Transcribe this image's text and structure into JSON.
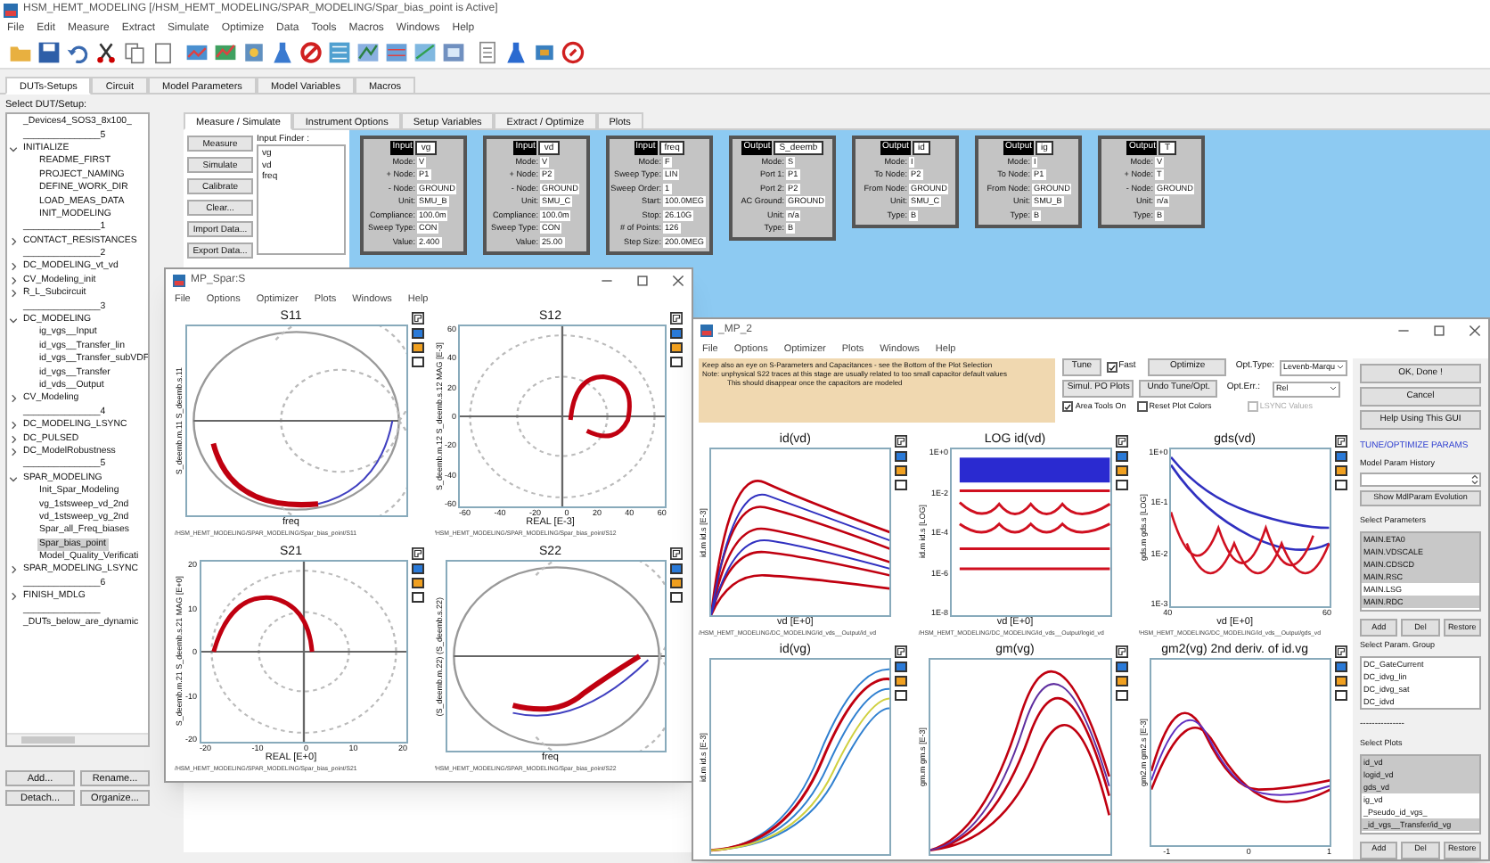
{
  "app": {
    "title": "HSM_HEMT_MODELING [/HSM_HEMT_MODELING/SPAR_MODELING/Spar_bias_point is Active]",
    "menu": [
      "File",
      "Edit",
      "Measure",
      "Extract",
      "Simulate",
      "Optimize",
      "Data",
      "Tools",
      "Macros",
      "Windows",
      "Help"
    ]
  },
  "main_tabs": [
    {
      "label": "DUTs-Setups",
      "selected": true
    },
    {
      "label": "Circuit",
      "selected": false
    },
    {
      "label": "Model Parameters",
      "selected": false
    },
    {
      "label": "Model Variables",
      "selected": false
    },
    {
      "label": "Macros",
      "selected": false
    }
  ],
  "dut_panel": {
    "label": "Select DUT/Setup:",
    "tree": [
      {
        "label": "_Devices4_SOS3_8x100_"
      },
      {
        "label": "_______________5"
      },
      {
        "label": "INITIALIZE",
        "expanded": true,
        "selected": false,
        "children": [
          {
            "label": "README_FIRST",
            "selected": false
          },
          {
            "label": "PROJECT_NAMING",
            "selected": false
          },
          {
            "label": "DEFINE_WORK_DIR",
            "selected": false
          },
          {
            "label": "LOAD_MEAS_DATA",
            "selected": false
          },
          {
            "label": "INIT_MODELING",
            "selected": false
          }
        ]
      },
      {
        "label": "_______________1"
      },
      {
        "label": "CONTACT_RESISTANCES",
        "expanded": false,
        "selected": false
      },
      {
        "label": "_______________2"
      },
      {
        "label": "DC_MODELING_vt_vd",
        "expanded": false,
        "selected": false
      },
      {
        "label": "CV_Modeling_init",
        "expanded": false,
        "selected": false
      },
      {
        "label": "R_L_Subcircuit",
        "expanded": false,
        "selected": false
      },
      {
        "label": "_______________3"
      },
      {
        "label": "DC_MODELING",
        "expanded": true,
        "selected": false,
        "children": [
          {
            "label": "ig_vgs__Input",
            "selected": false
          },
          {
            "label": "id_vgs__Transfer_lin",
            "selected": false
          },
          {
            "label": "id_vgs__Transfer_subVDF",
            "selected": false
          },
          {
            "label": "id_vgs__Transfer",
            "selected": false
          },
          {
            "label": "id_vds__Output",
            "selected": false
          }
        ]
      },
      {
        "label": "CV_Modeling",
        "expanded": false,
        "selected": false
      },
      {
        "label": "_______________4"
      },
      {
        "label": "DC_MODELING_LSYNC",
        "expanded": false,
        "selected": false
      },
      {
        "label": "DC_PULSED",
        "expanded": false,
        "selected": false
      },
      {
        "label": "DC_ModelRobustness",
        "expanded": false,
        "selected": false
      },
      {
        "label": "_______________5"
      },
      {
        "label": "SPAR_MODELING",
        "expanded": true,
        "selected": false,
        "children": [
          {
            "label": "Init_Spar_Modeling",
            "selected": false
          },
          {
            "label": "vg_1stsweep_vd_2nd",
            "selected": false
          },
          {
            "label": "vd_1stsweep_vg_2nd",
            "selected": false
          },
          {
            "label": "Spar_all_Freq_biases",
            "selected": false
          },
          {
            "label": "Spar_bias_point",
            "selected": true
          },
          {
            "label": "Model_Quality_Verificati",
            "selected": false
          }
        ]
      },
      {
        "label": "SPAR_MODELING_LSYNC",
        "expanded": false,
        "selected": false
      },
      {
        "label": "_______________6"
      },
      {
        "label": "FINISH_MDLG",
        "expanded": false,
        "selected": false
      },
      {
        "label": "_______________"
      },
      {
        "label": "_DUTs_below_are_dynamic"
      }
    ],
    "buttons": [
      "Add...",
      "Rename...",
      "Detach...",
      "Organize..."
    ]
  },
  "setup_tabs": [
    {
      "label": "Measure / Simulate",
      "selected": true
    },
    {
      "label": "Instrument Options",
      "selected": false
    },
    {
      "label": "Setup Variables",
      "selected": false
    },
    {
      "label": "Extract / Optimize",
      "selected": false
    },
    {
      "label": "Plots",
      "selected": false
    }
  ],
  "action_buttons": [
    "Measure",
    "Simulate",
    "Calibrate",
    "Clear...",
    "Import Data...",
    "Export Data..."
  ],
  "input_finder": {
    "label": "Input Finder :",
    "items": [
      "vg",
      "vd",
      "freq"
    ]
  },
  "blocks": [
    {
      "header": "Input",
      "name": "vg",
      "fields": [
        [
          "Mode:",
          "V"
        ],
        [
          "+ Node:",
          "P1"
        ],
        [
          "- Node:",
          "GROUND"
        ],
        [
          "Unit:",
          "SMU_B"
        ],
        [
          "Compliance:",
          "100.0m"
        ],
        [
          "Sweep Type:",
          "CON"
        ],
        [
          "Value:",
          "2.400"
        ]
      ]
    },
    {
      "header": "Input",
      "name": "vd",
      "fields": [
        [
          "Mode:",
          "V"
        ],
        [
          "+ Node:",
          "P2"
        ],
        [
          "- Node:",
          "GROUND"
        ],
        [
          "Unit:",
          "SMU_C"
        ],
        [
          "Compliance:",
          "100.0m"
        ],
        [
          "Sweep Type:",
          "CON"
        ],
        [
          "Value:",
          "25.00"
        ]
      ]
    },
    {
      "header": "Input",
      "name": "freq",
      "fields": [
        [
          "Mode:",
          "F"
        ],
        [
          "Sweep Type:",
          "LIN"
        ],
        [
          "Sweep Order:",
          "1"
        ],
        [
          "Start:",
          "100.0MEG"
        ],
        [
          "Stop:",
          "26.10G"
        ],
        [
          "# of Points:",
          "126"
        ],
        [
          "Step Size:",
          "200.0MEG"
        ]
      ]
    },
    {
      "header": "Output",
      "name": "S_deemb",
      "fields": [
        [
          "Mode:",
          "S"
        ],
        [
          "Port 1:",
          "P1"
        ],
        [
          "Port 2:",
          "P2"
        ],
        [
          "AC Ground:",
          "GROUND"
        ],
        [
          "Unit:",
          "n/a"
        ],
        [
          "Type:",
          "B"
        ]
      ]
    },
    {
      "header": "Output",
      "name": "id",
      "fields": [
        [
          "Mode:",
          "I"
        ],
        [
          "To Node:",
          "P2"
        ],
        [
          "From Node:",
          "GROUND"
        ],
        [
          "Unit:",
          "SMU_C"
        ],
        [
          "Type:",
          "B"
        ]
      ]
    },
    {
      "header": "Output",
      "name": "ig",
      "fields": [
        [
          "Mode:",
          "I"
        ],
        [
          "To Node:",
          "P1"
        ],
        [
          "From Node:",
          "GROUND"
        ],
        [
          "Unit:",
          "SMU_B"
        ],
        [
          "Type:",
          "B"
        ]
      ]
    },
    {
      "header": "Output",
      "name": "T",
      "fields": [
        [
          "Mode:",
          "V"
        ],
        [
          "+ Node:",
          "T"
        ],
        [
          "- Node:",
          "GROUND"
        ],
        [
          "Unit:",
          "n/a"
        ],
        [
          "Type:",
          "B"
        ]
      ]
    }
  ],
  "spar_window": {
    "title": "MP_Spar:S",
    "menu": [
      "File",
      "Options",
      "Optimizer",
      "Plots",
      "Windows",
      "Help"
    ],
    "plots": [
      {
        "kind": "smith",
        "title": "S11",
        "ylabel": "S_deemb.m.11  S_deemb.s.11",
        "xlabel": "freq",
        "footer": "/HSM_HEMT_MODELING/SPAR_MODELING/Spar_bias_point/S11"
      },
      {
        "kind": "polar",
        "title": "S12",
        "ylabel": "S_deemb.m.12  S_deemb.s.12  MAG [E-3]",
        "xlabel": "REAL [E-3]",
        "yticks": [
          "60",
          "40",
          "20",
          "0",
          "-20",
          "-40",
          "-60"
        ],
        "xticks": [
          "-60",
          "-40",
          "-20",
          "0",
          "20",
          "40",
          "60"
        ],
        "footer": "/HSM_HEMT_MODELING/SPAR_MODELING/Spar_bias_point/S12"
      },
      {
        "kind": "polar-half",
        "title": "S21",
        "ylabel": "S_deemb.m.21  S_deemb.s.21  MAG [E+0]",
        "xlabel": "REAL [E+0]",
        "yticks": [
          "20",
          "10",
          "0",
          "-10",
          "-20"
        ],
        "xticks": [
          "-20",
          "-10",
          "0",
          "10",
          "20"
        ],
        "footer": "/HSM_HEMT_MODELING/SPAR_MODELING/Spar_bias_point/S21"
      },
      {
        "kind": "smith-low",
        "title": "S22",
        "ylabel": "(S_deemb.m.22)  (S_deemb.s.22)",
        "xlabel": "freq",
        "footer": "/HSM_HEMT_MODELING/SPAR_MODELING/Spar_bias_point/S22"
      }
    ]
  },
  "mp2_window": {
    "title": "_MP_2",
    "menu": [
      "File",
      "Options",
      "Optimizer",
      "Plots",
      "Windows",
      "Help"
    ],
    "note": [
      "Keep also an eye on S-Parameters and Capacitances - see the Bottom of the Plot Selection",
      "Note: unphysical S22 traces at this stage are usually related to too small capacitor default values",
      "This should disappear once the capacitors are modeled"
    ],
    "tune_button": "Tune",
    "fast": {
      "label": "Fast",
      "checked": true
    },
    "optimize_button": "Optimize",
    "simul_button": "Simul. PO Plots",
    "undo_button": "Undo Tune/Opt.",
    "area_tools": {
      "label": "Area Tools On",
      "checked": true
    },
    "reset_colors": {
      "label": "Reset Plot Colors",
      "checked": false
    },
    "opt_type": {
      "label": "Opt.Type:",
      "value": "Levenb-Marqu"
    },
    "opt_err": {
      "label": "Opt.Err.:",
      "value": "Rel"
    },
    "lsync": {
      "label": "LSYNC Values",
      "checked": false,
      "disabled": true
    },
    "plots": [
      {
        "kind": "rise",
        "title": "id(vd)",
        "ylabel": "id.m  id.s  [E-3]",
        "xlabel": "vd [E+0]",
        "footer": "/HSM_HEMT_MODELING/DC_MODELING/id_vds__Output/id_vd"
      },
      {
        "kind": "log",
        "title": "LOG id(vd)",
        "ylabel": "id.m  id.s  [LOG]",
        "xlabel": "vd [E+0]",
        "yticks": [
          "1E+0",
          "1E-2",
          "1E-4",
          "1E-6",
          "1E-8"
        ],
        "footer": "/HSM_HEMT_MODELING/DC_MODELING/id_vds__Output/logid_vd"
      },
      {
        "kind": "dips",
        "title": "gds(vd)",
        "ylabel": "gds.m  gds.s  [LOG]",
        "xlabel": "vd [E+0]",
        "yticks": [
          "1E+0",
          "1E-1",
          "1E-2",
          "1E-3"
        ],
        "xticks": [
          "40",
          "60"
        ],
        "footer": "/HSM_HEMT_MODELING/DC_MODELING/id_vds__Output/gds_vd"
      },
      {
        "kind": "scurve",
        "title": "id(vg)",
        "ylabel": "id.m  id.s  [E-3]"
      },
      {
        "kind": "peak",
        "title": "gm(vg)",
        "ylabel": "gm.m  gm.s  [E-3]"
      },
      {
        "kind": "wave",
        "title": "gm2(vg)  2nd deriv. of id.vg",
        "ylabel": "gm2.m  gm2.s  [E-3]",
        "xticks": [
          "-1",
          "0",
          "1"
        ]
      }
    ],
    "side": {
      "ok": "OK, Done !",
      "cancel": "Cancel",
      "help": "Help Using This GUI",
      "section": "TUNE/OPTIMIZE PARAMS",
      "history_label": "Model Param History",
      "evolution_button": "Show MdlParam Evolution",
      "params_label": "Select Parameters",
      "params": [
        {
          "label": "MAIN.ETA0",
          "selected": true
        },
        {
          "label": "MAIN.VDSCALE",
          "selected": true
        },
        {
          "label": "MAIN.CDSCD",
          "selected": true
        },
        {
          "label": "MAIN.RSC",
          "selected": true
        },
        {
          "label": "MAIN.LSG",
          "selected": false
        },
        {
          "label": "MAIN.RDC",
          "selected": true
        }
      ],
      "buttons1": [
        "Add",
        "Del",
        "Restore"
      ],
      "group_label": "Select Param. Group",
      "groups": [
        "DC_GateCurrent",
        "DC_idvg_lin",
        "DC_idvg_sat",
        "DC_idvd"
      ],
      "divider": "---------------",
      "plots_label": "Select Plots",
      "plot_items": [
        {
          "label": "id_vd",
          "selected": true
        },
        {
          "label": "logid_vd",
          "selected": true
        },
        {
          "label": "gds_vd",
          "selected": true
        },
        {
          "label": "ig_vd",
          "selected": false
        },
        {
          "label": "_Pseudo_id_vgs_",
          "selected": false
        },
        {
          "label": "_id_vgs__Transfer/id_vg",
          "selected": true
        }
      ],
      "buttons2": [
        "Add",
        "Del",
        "Restore"
      ]
    }
  }
}
